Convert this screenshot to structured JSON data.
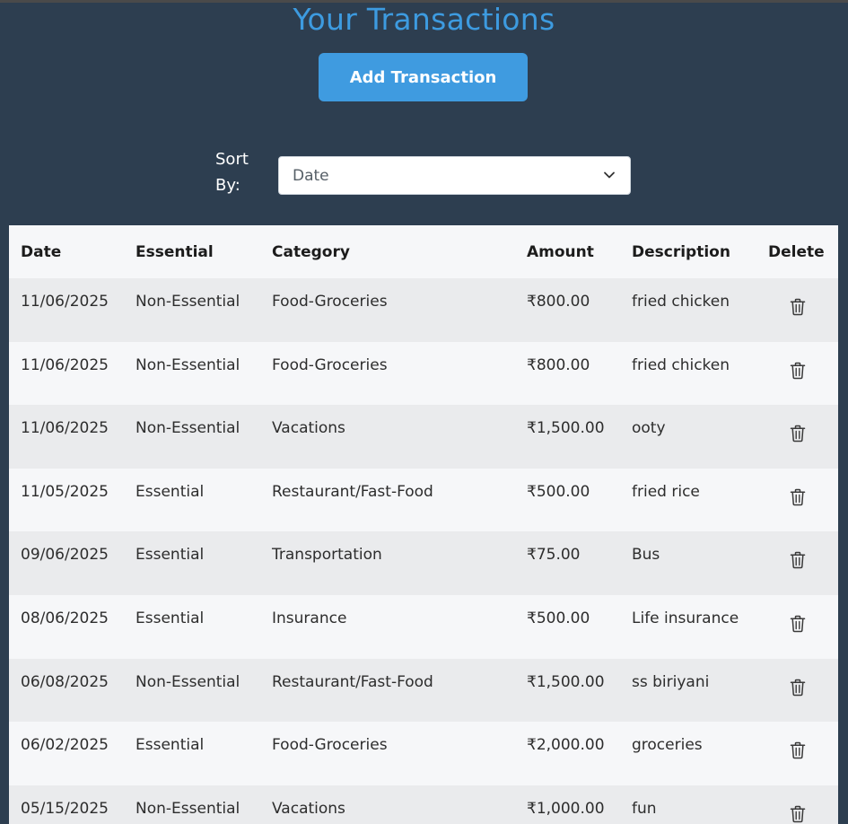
{
  "page": {
    "title": "Your Transactions",
    "add_button": "Add Transaction",
    "sort_label": "Sort By:",
    "sort_value": "Date"
  },
  "colors": {
    "background": "#2d3e50",
    "accent": "#3d9be0",
    "row_alt": "#eaebed",
    "row": "#f6f7f9"
  },
  "table": {
    "headers": [
      "Date",
      "Essential",
      "Category",
      "Amount",
      "Description",
      "Delete"
    ],
    "rows": [
      {
        "date": "11/06/2025",
        "essential": "Non-Essential",
        "category": "Food-Groceries",
        "amount": "₹800.00",
        "description": "fried chicken"
      },
      {
        "date": "11/06/2025",
        "essential": "Non-Essential",
        "category": "Food-Groceries",
        "amount": "₹800.00",
        "description": "fried chicken"
      },
      {
        "date": "11/06/2025",
        "essential": "Non-Essential",
        "category": "Vacations",
        "amount": "₹1,500.00",
        "description": "ooty"
      },
      {
        "date": "11/05/2025",
        "essential": "Essential",
        "category": "Restaurant/Fast-Food",
        "amount": "₹500.00",
        "description": "fried rice"
      },
      {
        "date": "09/06/2025",
        "essential": "Essential",
        "category": "Transportation",
        "amount": "₹75.00",
        "description": "Bus"
      },
      {
        "date": "08/06/2025",
        "essential": "Essential",
        "category": "Insurance",
        "amount": "₹500.00",
        "description": "Life insurance"
      },
      {
        "date": "06/08/2025",
        "essential": "Non-Essential",
        "category": "Restaurant/Fast-Food",
        "amount": "₹1,500.00",
        "description": "ss biriyani"
      },
      {
        "date": "06/02/2025",
        "essential": "Essential",
        "category": "Food-Groceries",
        "amount": "₹2,000.00",
        "description": "groceries"
      },
      {
        "date": "05/15/2025",
        "essential": "Non-Essential",
        "category": "Vacations",
        "amount": "₹1,000.00",
        "description": "fun"
      }
    ],
    "delete_icon": "trash-icon"
  }
}
